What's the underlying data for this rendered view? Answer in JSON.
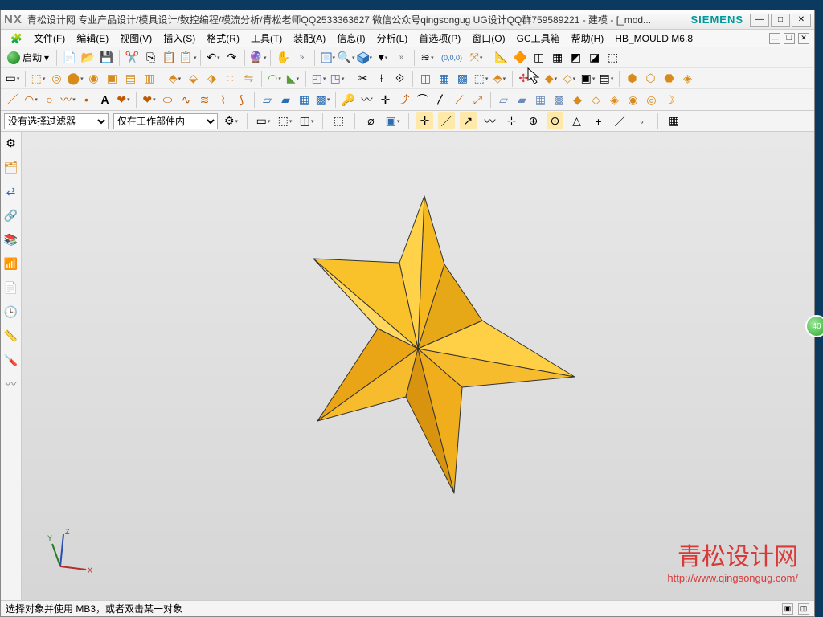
{
  "title": "青松设计网 专业产品设计/模具设计/数控编程/模流分析/青松老师QQ2533363627 微信公众号qingsongug UG设计QQ群759589221 - 建模 - [_mod...",
  "brand": "SIEMENS",
  "menu": {
    "file": "文件(F)",
    "edit": "编辑(E)",
    "view": "视图(V)",
    "insert": "插入(S)",
    "format": "格式(R)",
    "tools": "工具(T)",
    "assemblies": "装配(A)",
    "info": "信息(I)",
    "analysis": "分析(L)",
    "preferences": "首选项(P)",
    "window": "窗口(O)",
    "gctoolkit": "GC工具箱",
    "help": "帮助(H)",
    "hbmould": "HB_MOULD M6.8"
  },
  "toolbar": {
    "start": "启动"
  },
  "selection": {
    "filter": "没有选择过滤器",
    "scope": "仅在工作部件内"
  },
  "watermark": {
    "text": "青松设计网",
    "url": "http://www.qingsongug.com/"
  },
  "status": {
    "message": "选择对象并使用 MB3，或者双击某一对象"
  },
  "badge": "40"
}
